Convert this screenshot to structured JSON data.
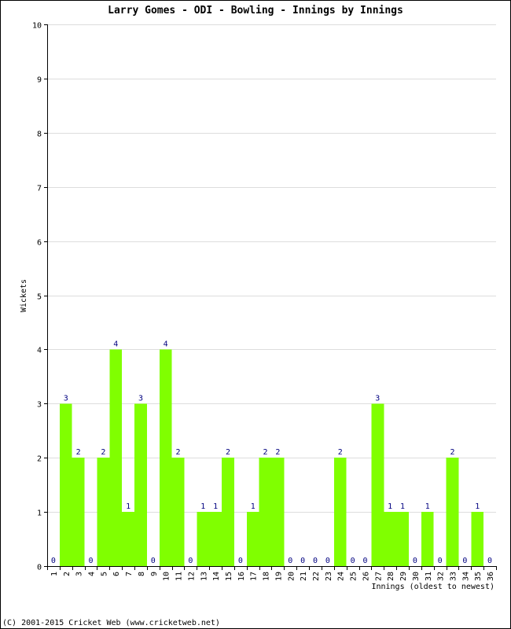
{
  "chart_data": {
    "type": "bar",
    "title": "Larry Gomes - ODI - Bowling - Innings by Innings",
    "xlabel": "Innings (oldest to newest)",
    "ylabel": "Wickets",
    "ylim": [
      0,
      10
    ],
    "yticks": [
      0,
      1,
      2,
      3,
      4,
      5,
      6,
      7,
      8,
      9,
      10
    ],
    "grid": true,
    "bar_color": "#80ff00",
    "label_color": "#000080",
    "categories": [
      "1",
      "2",
      "3",
      "4",
      "5",
      "6",
      "7",
      "8",
      "9",
      "10",
      "11",
      "12",
      "13",
      "14",
      "15",
      "16",
      "17",
      "18",
      "19",
      "20",
      "21",
      "22",
      "23",
      "24",
      "25",
      "26",
      "27",
      "28",
      "29",
      "30",
      "31",
      "32",
      "33",
      "34",
      "35",
      "36"
    ],
    "values": [
      0,
      3,
      2,
      0,
      2,
      4,
      1,
      3,
      0,
      4,
      2,
      0,
      1,
      1,
      2,
      0,
      1,
      2,
      2,
      0,
      0,
      0,
      0,
      2,
      0,
      0,
      3,
      1,
      1,
      0,
      1,
      0,
      2,
      0,
      1,
      0
    ]
  },
  "footer": "(C) 2001-2015 Cricket Web (www.cricketweb.net)"
}
